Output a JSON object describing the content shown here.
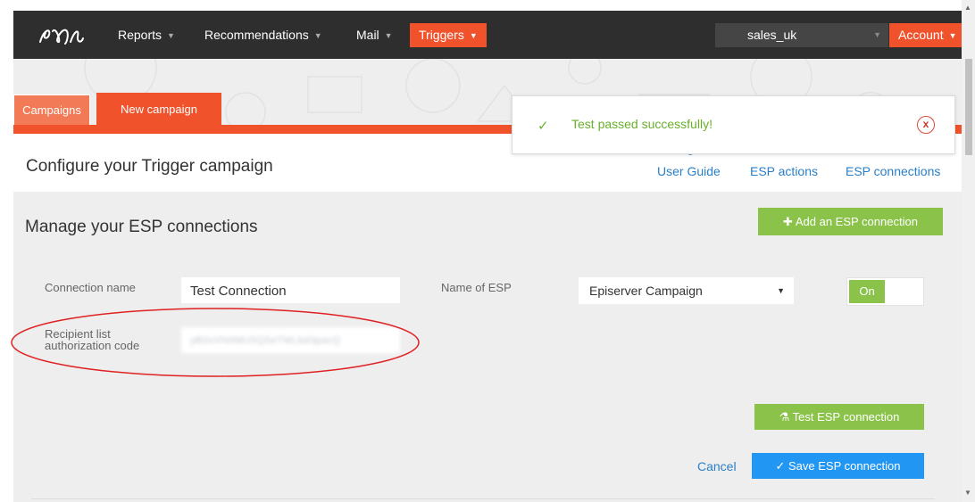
{
  "nav": {
    "logo": "epi",
    "items": [
      "Reports",
      "Recommendations",
      "Mail"
    ],
    "active": "Triggers",
    "tenant": "sales_uk",
    "account": "Account"
  },
  "tabs": {
    "campaigns": "Campaigns",
    "new_campaign": "New campaign"
  },
  "header": {
    "title": "Configure your Trigger campaign",
    "links": [
      "User Guide",
      "ESP actions",
      "ESP connections"
    ]
  },
  "section": {
    "title": "Manage your ESP connections",
    "add_button": "Add an ESP connection"
  },
  "form": {
    "connection_name_label": "Connection name",
    "connection_name_value": "Test Connection",
    "esp_label": "Name of ESP",
    "esp_value": "Episerver Campaign",
    "toggle": "On",
    "auth_label_1": "Recipient list",
    "auth_label_2": "authorization code",
    "auth_value": "yB0uVN9MU5Q5eTMLbd3pacQ"
  },
  "actions": {
    "test": "Test ESP connection",
    "cancel": "Cancel",
    "save": "Save ESP connection"
  },
  "toast": {
    "message": "Test passed successfully!",
    "close": "x"
  },
  "colors": {
    "accent": "#f0522c",
    "green": "#8bc34a",
    "blue": "#2196f3",
    "link": "#2a7fc7",
    "nav_bg": "#2e2e2e"
  }
}
